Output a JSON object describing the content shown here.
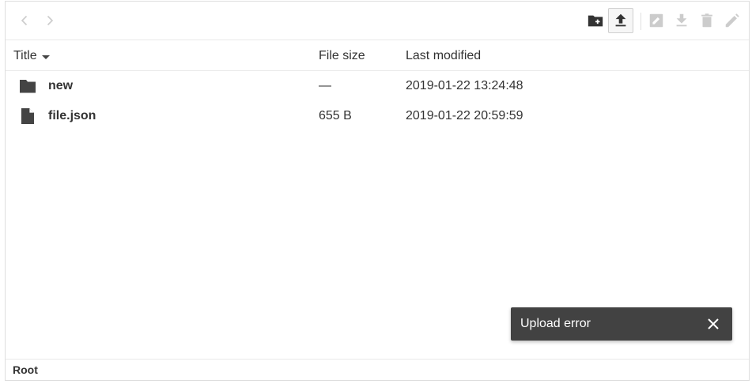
{
  "colors": {
    "icon_active": "#333333",
    "icon_disabled": "#cccccc",
    "snackbar_bg": "#424242",
    "border": "#e9e9e9"
  },
  "toolbar": {
    "nav": [
      {
        "icon": "chevron-left-icon",
        "enabled": false
      },
      {
        "icon": "chevron-right-icon",
        "enabled": false
      }
    ],
    "actions": [
      {
        "icon": "create-folder-icon",
        "enabled": true
      },
      {
        "icon": "upload-icon",
        "enabled": true,
        "active": true
      },
      {
        "icon": "rename-icon",
        "enabled": false
      },
      {
        "icon": "download-icon",
        "enabled": false
      },
      {
        "icon": "delete-icon",
        "enabled": false
      },
      {
        "icon": "edit-icon",
        "enabled": false
      }
    ]
  },
  "table": {
    "columns": {
      "title": "Title",
      "size": "File size",
      "modified": "Last modified"
    },
    "sort": {
      "column": "title",
      "direction": "desc"
    },
    "rows": [
      {
        "type": "folder",
        "icon": "folder-icon",
        "name": "new",
        "size": "—",
        "modified": "2019-01-22 13:24:48"
      },
      {
        "type": "file",
        "icon": "file-icon",
        "name": "file.json",
        "size": "655 B",
        "modified": "2019-01-22 20:59:59"
      }
    ]
  },
  "statusbar": {
    "breadcrumb": "Root"
  },
  "snackbar": {
    "message": "Upload error",
    "close_icon": "close-icon"
  }
}
